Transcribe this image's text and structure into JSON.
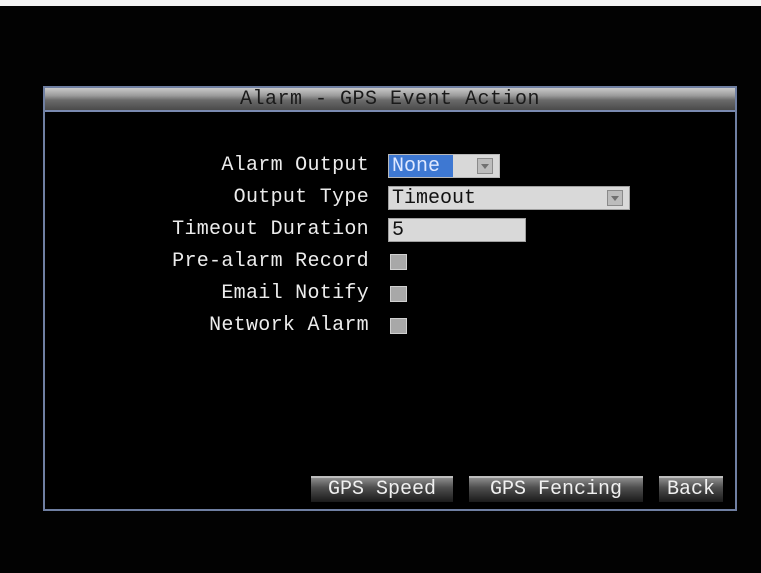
{
  "dialog": {
    "title": "Alarm - GPS Event Action"
  },
  "fields": {
    "alarm_output": {
      "label": "Alarm Output",
      "value": "None"
    },
    "output_type": {
      "label": "Output Type",
      "value": "Timeout"
    },
    "timeout_duration": {
      "label": "Timeout Duration",
      "value": "5"
    },
    "pre_alarm_record": {
      "label": "Pre-alarm Record",
      "checked": false
    },
    "email_notify": {
      "label": "Email Notify",
      "checked": false
    },
    "network_alarm": {
      "label": "Network Alarm",
      "checked": false
    }
  },
  "buttons": {
    "gps_speed": "GPS Speed",
    "gps_fencing": "GPS Fencing",
    "back": "Back"
  },
  "colors": {
    "background": "#020202",
    "border": "#6f7fa2",
    "highlight": "#3e78d2",
    "field": "#d9d9d9"
  }
}
